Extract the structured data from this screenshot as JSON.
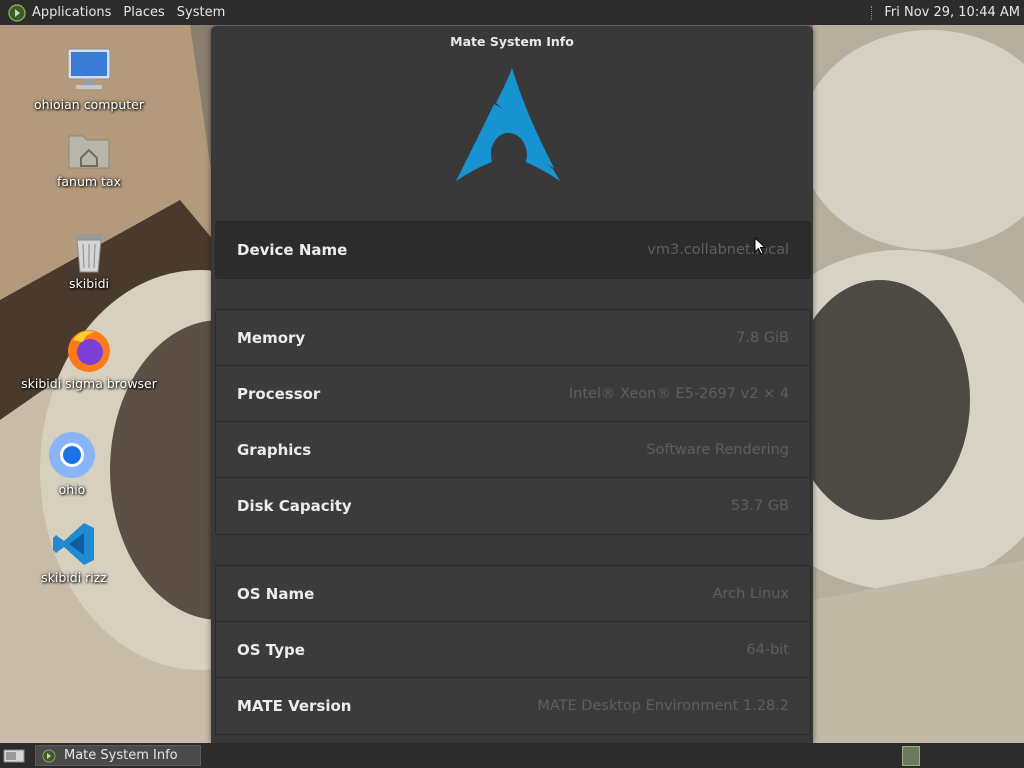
{
  "top_panel": {
    "menus": [
      "Applications",
      "Places",
      "System"
    ],
    "clock": "Fri Nov 29, 10:44 AM"
  },
  "desktop_icons": [
    {
      "label": "ohioian computer",
      "icon": "computer-icon"
    },
    {
      "label": "fanum tax",
      "icon": "home-folder-icon"
    },
    {
      "label": "skibidi",
      "icon": "trash-icon"
    },
    {
      "label": "skibidi sigma browser",
      "icon": "firefox-icon"
    },
    {
      "label": "ohio",
      "icon": "chromium-icon"
    },
    {
      "label": "skibidi rizz",
      "icon": "vscode-icon"
    }
  ],
  "window": {
    "title": "Mate System Info",
    "logo": "arch-linux-logo-icon",
    "device": {
      "key": "Device Name",
      "value": "vm3.collabnet.local"
    },
    "hardware": [
      {
        "key": "Memory",
        "value": "7.8 GiB"
      },
      {
        "key": "Processor",
        "value": "Intel® Xeon® E5-2697 v2 × 4"
      },
      {
        "key": "Graphics",
        "value": "Software Rendering"
      },
      {
        "key": "Disk Capacity",
        "value": "53.7 GB"
      }
    ],
    "software": [
      {
        "key": "OS Name",
        "value": "Arch Linux"
      },
      {
        "key": "OS Type",
        "value": "64-bit"
      },
      {
        "key": "MATE Version",
        "value": "MATE Desktop Environment 1.28.2"
      }
    ]
  },
  "bottom_panel": {
    "task_label": "Mate System Info"
  },
  "colors": {
    "panel": "#2c2c2c",
    "window_bg": "#393939",
    "arch_blue": "#1793d1"
  }
}
